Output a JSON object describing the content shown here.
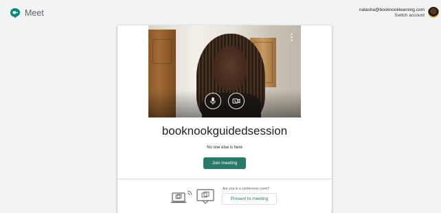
{
  "app": {
    "name": "Meet"
  },
  "account": {
    "email": "natasha@booknooklearning.com",
    "switch_label": "Switch account"
  },
  "meeting": {
    "title": "booknookguidedsession",
    "status": "No one else is here",
    "join_label": "Join meeting"
  },
  "conference": {
    "question": "Are you in a conference room?",
    "present_label": "Present to meeting"
  },
  "colors": {
    "accent": "#2a7a6a",
    "brand_green": "#00897b",
    "background": "#f1f3f4"
  },
  "icons": [
    "meet-logo-icon",
    "avatar",
    "more-options-icon",
    "microphone-icon",
    "camera-off-icon",
    "laptop-cast-icon",
    "tv-cast-icon"
  ]
}
